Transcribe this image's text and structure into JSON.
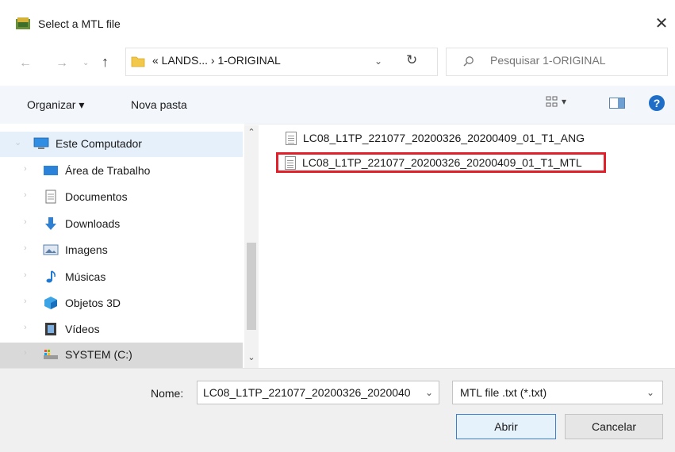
{
  "window": {
    "title": "Select a MTL file",
    "close_glyph": "✕"
  },
  "nav": {
    "back_glyph": "←",
    "forward_glyph": "→",
    "recent_glyph": "⌄",
    "up_glyph": "↑",
    "address_path": "« LANDS...  ›  1-ORIGINAL",
    "address_dropdown_glyph": "⌄",
    "refresh_glyph": "↻",
    "search_placeholder": "Pesquisar 1-ORIGINAL"
  },
  "toolbar": {
    "organize_label": "Organizar ▾",
    "new_folder_label": "Nova pasta",
    "view_glyph": "▾",
    "help_glyph": "?"
  },
  "sidebar": {
    "items": [
      {
        "label": "Este Computador",
        "icon": "computer-icon",
        "expanded": true
      },
      {
        "label": "Área de Trabalho",
        "icon": "desktop-icon"
      },
      {
        "label": "Documentos",
        "icon": "documents-icon"
      },
      {
        "label": "Downloads",
        "icon": "downloads-icon"
      },
      {
        "label": "Imagens",
        "icon": "pictures-icon"
      },
      {
        "label": "Músicas",
        "icon": "music-icon"
      },
      {
        "label": "Objetos 3D",
        "icon": "3d-objects-icon"
      },
      {
        "label": "Vídeos",
        "icon": "videos-icon"
      },
      {
        "label": "SYSTEM (C:)",
        "icon": "drive-icon",
        "selected": true
      }
    ],
    "chevron_glyph": "›",
    "expanded_chevron_glyph": "⌄",
    "scroll_up_glyph": "⌃",
    "scroll_down_glyph": "⌄"
  },
  "files": [
    {
      "name": "LC08_L1TP_221077_20200326_20200409_01_T1_ANG",
      "highlighted": false
    },
    {
      "name": "LC08_L1TP_221077_20200326_20200409_01_T1_MTL",
      "highlighted": true
    }
  ],
  "bottom": {
    "name_label": "Nome:",
    "name_value": "LC08_L1TP_221077_20200326_2020040",
    "filter_value": "MTL file .txt (*.txt)",
    "dropdown_glyph": "⌄",
    "open_label": "Abrir",
    "cancel_label": "Cancelar"
  },
  "colors": {
    "highlight_border": "#e0202a",
    "toolbar_bg": "#f3f6fb",
    "selected_bg": "#d9d9d9",
    "accent": "#1e6ec8"
  }
}
